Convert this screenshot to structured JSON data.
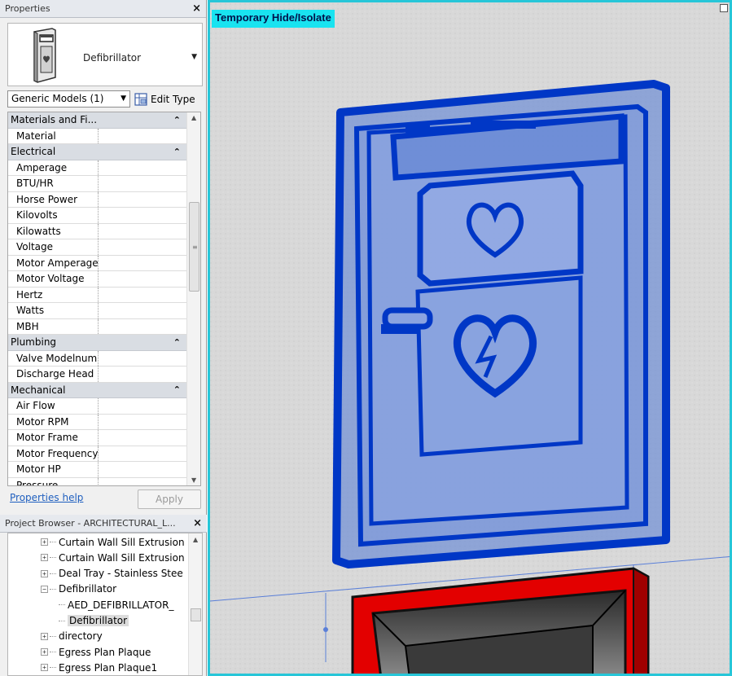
{
  "properties": {
    "title": "Properties",
    "close": "×",
    "type_name": "Defibrillator",
    "filter": "Generic Models (1)",
    "edit_type": "Edit Type",
    "help": "Properties help",
    "apply": "Apply",
    "groups": [
      {
        "label": "Materials and Fi...",
        "rows": [
          "Material"
        ]
      },
      {
        "label": "Electrical",
        "rows": [
          "Amperage",
          "BTU/HR",
          "Horse Power",
          "Kilovolts",
          "Kilowatts",
          "Voltage",
          "Motor Amperage",
          "Motor Voltage",
          "Hertz",
          "Watts",
          "MBH"
        ]
      },
      {
        "label": "Plumbing",
        "rows": [
          "Valve Modelnum",
          "Discharge Head"
        ]
      },
      {
        "label": "Mechanical",
        "rows": [
          "Air Flow",
          "Motor RPM",
          "Motor Frame",
          "Motor Frequency",
          "Motor HP",
          "Pressure"
        ]
      }
    ]
  },
  "project_browser": {
    "title": "Project Browser - ARCHITECTURAL_L...",
    "close": "×",
    "items": [
      {
        "label": "Curtain Wall Sill Extrusion"
      },
      {
        "label": "Curtain Wall Sill Extrusion"
      },
      {
        "label": "Deal Tray - Stainless Stee"
      },
      {
        "label": "Defibrillator"
      },
      {
        "label": "AED_DEFIBRILLATOR_"
      },
      {
        "label": "Defibrillator"
      },
      {
        "label": "directory"
      },
      {
        "label": "Egress Plan Plaque"
      },
      {
        "label": "Egress Plan Plaque1"
      }
    ]
  },
  "viewport": {
    "mode_label": "Temporary Hide/Isolate",
    "selection_color": "#0037c6",
    "highlight_color": "#e30000",
    "border_color": "#27c6d8"
  }
}
